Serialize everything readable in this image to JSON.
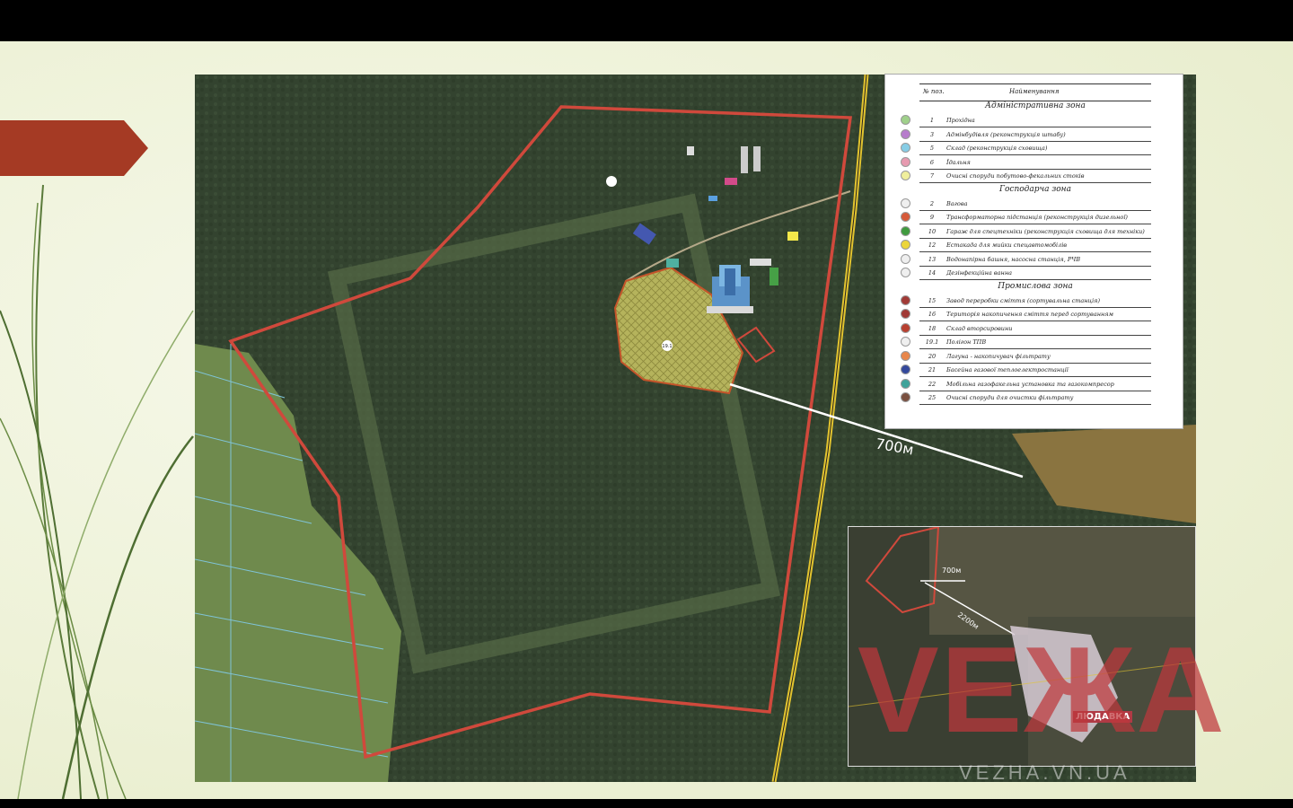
{
  "legend": {
    "col_num": "№ поз.",
    "col_name": "Найменування",
    "sections": [
      {
        "title": "Адміністративна зона",
        "items": [
          {
            "num": "1",
            "label": "Прохідна",
            "color": "#9fd08a"
          },
          {
            "num": "3",
            "label": "Адмінбудівля (реконструкція штабу)",
            "color": "#b77ccc"
          },
          {
            "num": "5",
            "label": "Склад (реконструкція сховища)",
            "color": "#86cde6"
          },
          {
            "num": "6",
            "label": "Їдальня",
            "color": "#e79ab0"
          },
          {
            "num": "7",
            "label": "Очисні споруди побутово-фекальних стоків",
            "color": "#f0ef9c"
          }
        ]
      },
      {
        "title": "Господарча зона",
        "items": [
          {
            "num": "2",
            "label": "Вагова",
            "color": "#efefef"
          },
          {
            "num": "9",
            "label": "Трансформаторна підстанція (реконструкція дизельної)",
            "color": "#d65a3a"
          },
          {
            "num": "10",
            "label": "Гараж для спецтехніки (реконструкція сховища для техніки)",
            "color": "#3f9a3f"
          },
          {
            "num": "12",
            "label": "Естакада для мийки спецавтомобілів",
            "color": "#ecd63a"
          },
          {
            "num": "13",
            "label": "Водонапірна башня, насосна станція, РЧВ",
            "color": "#efefef"
          },
          {
            "num": "14",
            "label": "Дезінфекційна ванна",
            "color": "#efefef"
          }
        ]
      },
      {
        "title": "Промислова зона",
        "items": [
          {
            "num": "15",
            "label": "Завод переробки сміття (сортувальна станція)",
            "color": "#a13a36"
          },
          {
            "num": "16",
            "label": "Територія накопичення сміття перед сортуванням",
            "color": "#a13a36"
          },
          {
            "num": "18",
            "label": "Склад вторсировини",
            "color": "#b84030"
          },
          {
            "num": "19.1",
            "label": "Полігон ТПВ",
            "color": "#efefef"
          },
          {
            "num": "20",
            "label": "Лагуна - накопичувач фільтрату",
            "color": "#e8864a"
          },
          {
            "num": "21",
            "label": "Басейна газової теплоелектростанції",
            "color": "#34499c"
          },
          {
            "num": "22",
            "label": "Мобільна газофакельна установка та газокомпресор",
            "color": "#3fa39a"
          },
          {
            "num": "25",
            "label": "Очисні споруди для очистки фільтрату",
            "color": "#7a5040"
          }
        ]
      }
    ]
  },
  "map": {
    "distance_label": "700м",
    "site_marker": "19.1"
  },
  "inset": {
    "distance_1": "700м",
    "distance_2": "2200м",
    "village": "ЛЮДАВКА"
  },
  "watermark": {
    "brand": "VEЖА",
    "url": "VEZHA.VN.UA"
  },
  "colors": {
    "boundary": "#d0493c",
    "ribbon": "#a53a24",
    "road_yellow": "#e3c42f"
  }
}
